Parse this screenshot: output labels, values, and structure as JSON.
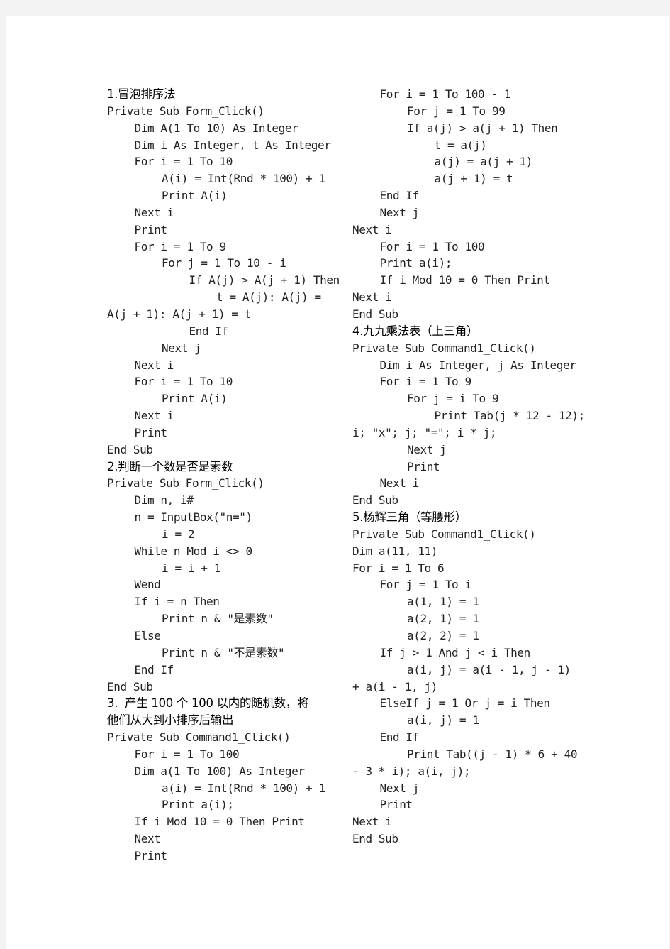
{
  "document": {
    "left_column": [
      {
        "type": "heading",
        "text": "1.冒泡排序法"
      },
      {
        "type": "code",
        "indent": 0,
        "text": "Private Sub Form_Click()"
      },
      {
        "type": "code",
        "indent": 1,
        "text": "Dim A(1 To 10) As Integer"
      },
      {
        "type": "code",
        "indent": 1,
        "text": "Dim i As Integer, t As Integer"
      },
      {
        "type": "code",
        "indent": 1,
        "text": "For i = 1 To 10"
      },
      {
        "type": "code",
        "indent": 2,
        "text": "A(i) = Int(Rnd * 100) + 1"
      },
      {
        "type": "code",
        "indent": 2,
        "text": "Print A(i)"
      },
      {
        "type": "code",
        "indent": 1,
        "text": "Next i"
      },
      {
        "type": "code",
        "indent": 1,
        "text": "Print"
      },
      {
        "type": "code",
        "indent": 1,
        "text": "For i = 1 To 9"
      },
      {
        "type": "code",
        "indent": 2,
        "text": "For j = 1 To 10 - i"
      },
      {
        "type": "code",
        "indent": 3,
        "text": "If A(j) > A(j + 1) Then"
      },
      {
        "type": "code",
        "indent": 4,
        "text": "t = A(j): A(j) ="
      },
      {
        "type": "code",
        "indent": 0,
        "text": "A(j + 1): A(j + 1) = t"
      },
      {
        "type": "code",
        "indent": 3,
        "text": "End If"
      },
      {
        "type": "code",
        "indent": 2,
        "text": "Next j"
      },
      {
        "type": "code",
        "indent": 1,
        "text": "Next i"
      },
      {
        "type": "code",
        "indent": 1,
        "text": "For i = 1 To 10"
      },
      {
        "type": "code",
        "indent": 2,
        "text": "Print A(i)"
      },
      {
        "type": "code",
        "indent": 1,
        "text": "Next i"
      },
      {
        "type": "code",
        "indent": 1,
        "text": "Print"
      },
      {
        "type": "code",
        "indent": 0,
        "text": "End Sub"
      },
      {
        "type": "heading",
        "text": "2.判断一个数是否是素数"
      },
      {
        "type": "code",
        "indent": 0,
        "text": "Private Sub Form_Click()"
      },
      {
        "type": "code",
        "indent": 1,
        "text": "Dim n, i#"
      },
      {
        "type": "code",
        "indent": 1,
        "text": "n = InputBox(\"n=\")"
      },
      {
        "type": "code",
        "indent": 2,
        "text": "i = 2"
      },
      {
        "type": "code",
        "indent": 1,
        "text": "While n Mod i <> 0"
      },
      {
        "type": "code",
        "indent": 2,
        "text": "i = i + 1"
      },
      {
        "type": "code",
        "indent": 1,
        "text": "Wend"
      },
      {
        "type": "code",
        "indent": 1,
        "text": "If i = n Then"
      },
      {
        "type": "code",
        "indent": 2,
        "text": "Print n & \"是素数\""
      },
      {
        "type": "code",
        "indent": 1,
        "text": "Else"
      },
      {
        "type": "code",
        "indent": 2,
        "text": "Print n & \"不是素数\""
      },
      {
        "type": "code",
        "indent": 1,
        "text": "End If"
      },
      {
        "type": "code",
        "indent": 0,
        "text": "End Sub"
      },
      {
        "type": "heading",
        "text": "3.  产生 100 个 100 以内的随机数，将"
      },
      {
        "type": "heading",
        "text": "他们从大到小排序后输出"
      },
      {
        "type": "code",
        "indent": 0,
        "text": "Private Sub Command1_Click()"
      },
      {
        "type": "code",
        "indent": 1,
        "text": "For i = 1 To 100"
      },
      {
        "type": "code",
        "indent": 1,
        "text": "Dim a(1 To 100) As Integer"
      },
      {
        "type": "code",
        "indent": 2,
        "text": "a(i) = Int(Rnd * 100) + 1"
      },
      {
        "type": "code",
        "indent": 2,
        "text": "Print a(i);"
      },
      {
        "type": "code",
        "indent": 1,
        "text": "If i Mod 10 = 0 Then Print"
      },
      {
        "type": "code",
        "indent": 1,
        "text": "Next"
      },
      {
        "type": "code",
        "indent": 1,
        "text": "Print"
      }
    ],
    "right_column": [
      {
        "type": "code",
        "indent": 1,
        "text": "For i = 1 To 100 - 1"
      },
      {
        "type": "code",
        "indent": 2,
        "text": "For j = 1 To 99"
      },
      {
        "type": "code",
        "indent": 2,
        "text": "If a(j) > a(j + 1) Then"
      },
      {
        "type": "code",
        "indent": 3,
        "text": "t = a(j)"
      },
      {
        "type": "code",
        "indent": 3,
        "text": "a(j) = a(j + 1)"
      },
      {
        "type": "code",
        "indent": 3,
        "text": "a(j + 1) = t"
      },
      {
        "type": "code",
        "indent": 1,
        "text": "End If"
      },
      {
        "type": "code",
        "indent": 1,
        "text": "Next j"
      },
      {
        "type": "code",
        "indent": 0,
        "text": "Next i"
      },
      {
        "type": "code",
        "indent": 1,
        "text": "For i = 1 To 100"
      },
      {
        "type": "code",
        "indent": 1,
        "text": "Print a(i);"
      },
      {
        "type": "code",
        "indent": 1,
        "text": "If i Mod 10 = 0 Then Print"
      },
      {
        "type": "code",
        "indent": 0,
        "text": "Next i"
      },
      {
        "type": "code",
        "indent": 0,
        "text": "End Sub"
      },
      {
        "type": "heading",
        "text": "4.九九乘法表（上三角）"
      },
      {
        "type": "code",
        "indent": 0,
        "text": "Private Sub Command1_Click()"
      },
      {
        "type": "code",
        "indent": 1,
        "text": "Dim i As Integer, j As Integer"
      },
      {
        "type": "code",
        "indent": 1,
        "text": "For i = 1 To 9"
      },
      {
        "type": "code",
        "indent": 2,
        "text": "For j = i To 9"
      },
      {
        "type": "code",
        "indent": 3,
        "text": "Print Tab(j * 12 - 12);"
      },
      {
        "type": "code",
        "indent": 0,
        "text": "i; \"x\"; j; \"=\"; i * j;"
      },
      {
        "type": "code",
        "indent": 2,
        "text": "Next j"
      },
      {
        "type": "code",
        "indent": 2,
        "text": "Print"
      },
      {
        "type": "code",
        "indent": 1,
        "text": "Next i"
      },
      {
        "type": "code",
        "indent": 0,
        "text": "End Sub"
      },
      {
        "type": "heading",
        "text": "5.杨辉三角（等腰形）"
      },
      {
        "type": "code",
        "indent": 0,
        "text": "Private Sub Command1_Click()"
      },
      {
        "type": "code",
        "indent": 0,
        "text": "Dim a(11, 11)"
      },
      {
        "type": "code",
        "indent": 0,
        "text": "For i = 1 To 6"
      },
      {
        "type": "code",
        "indent": 1,
        "text": "For j = 1 To i"
      },
      {
        "type": "code",
        "indent": 2,
        "text": "a(1, 1) = 1"
      },
      {
        "type": "code",
        "indent": 2,
        "text": "a(2, 1) = 1"
      },
      {
        "type": "code",
        "indent": 2,
        "text": "a(2, 2) = 1"
      },
      {
        "type": "code",
        "indent": 1,
        "text": "If j > 1 And j < i Then"
      },
      {
        "type": "code",
        "indent": 2,
        "text": "a(i, j) = a(i - 1, j - 1)"
      },
      {
        "type": "code",
        "indent": 0,
        "text": "+ a(i - 1, j)"
      },
      {
        "type": "code",
        "indent": 1,
        "text": "ElseIf j = 1 Or j = i Then"
      },
      {
        "type": "code",
        "indent": 2,
        "text": "a(i, j) = 1"
      },
      {
        "type": "code",
        "indent": 1,
        "text": "End If"
      },
      {
        "type": "code",
        "indent": 2,
        "text": "Print Tab((j - 1) * 6 + 40"
      },
      {
        "type": "code",
        "indent": 0,
        "text": "- 3 * i); a(i, j);"
      },
      {
        "type": "code",
        "indent": 1,
        "text": "Next j"
      },
      {
        "type": "code",
        "indent": 1,
        "text": "Print"
      },
      {
        "type": "code",
        "indent": 0,
        "text": "Next i"
      },
      {
        "type": "code",
        "indent": 0,
        "text": "End Sub"
      }
    ]
  }
}
